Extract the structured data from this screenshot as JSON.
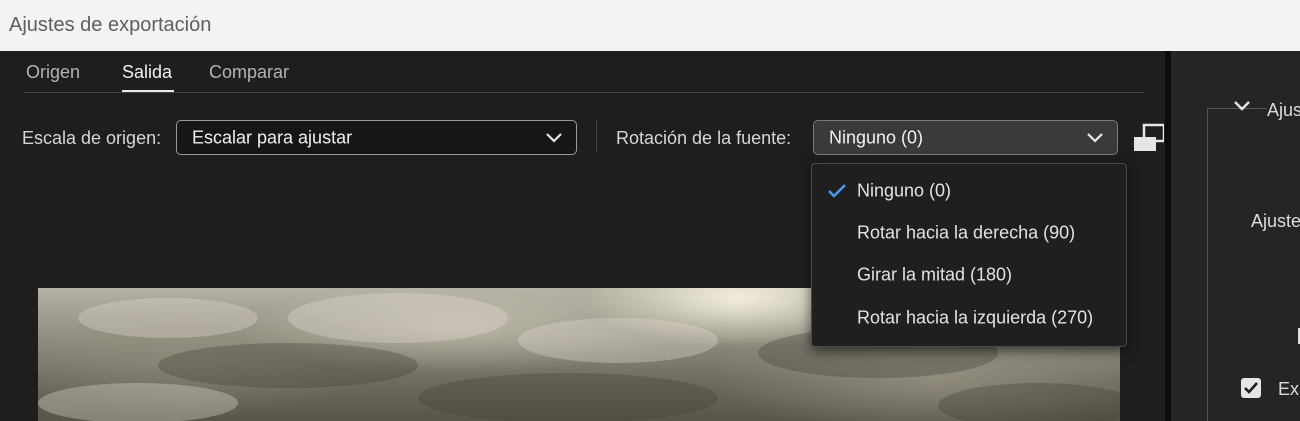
{
  "window": {
    "title": "Ajustes de exportación"
  },
  "tabs": [
    {
      "label": "Origen"
    },
    {
      "label": "Salida"
    },
    {
      "label": "Comparar"
    }
  ],
  "active_tab": "Salida",
  "source_scale": {
    "label": "Escala de origen:",
    "value": "Escalar para ajustar"
  },
  "source_rotation": {
    "label": "Rotación de la fuente:",
    "value": "Ninguno (0)",
    "options": [
      {
        "label": "Ninguno (0)",
        "selected": true
      },
      {
        "label": "Rotar hacia la derecha (90)",
        "selected": false
      },
      {
        "label": "Girar la mitad (180)",
        "selected": false
      },
      {
        "label": "Rotar hacia la izquierda (270)",
        "selected": false
      }
    ]
  },
  "right_panel": {
    "section_title": "Ajus",
    "row_label": "Ajuste",
    "checkbox_label": "Ex"
  },
  "icons": {
    "chevron": "chevron-down-icon",
    "check": "checkmark-icon",
    "crop": "crop-frame-icon"
  },
  "colors": {
    "accent": "#4b9cf5",
    "background": "#1e1e1e",
    "titlebar": "#f3f3f3"
  }
}
